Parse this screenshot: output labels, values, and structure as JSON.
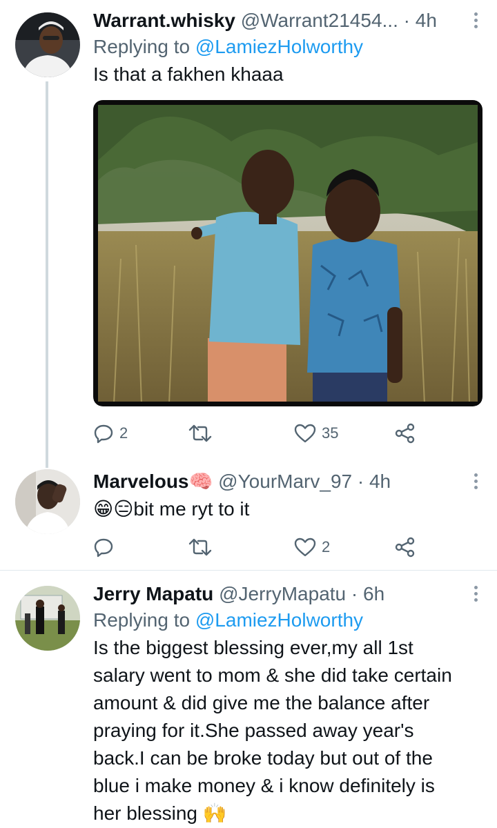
{
  "tweets": [
    {
      "name": "Warrant.whisky",
      "handle": "@Warrant21454...",
      "separator": "·",
      "time": "4h",
      "replying_prefix": "Replying to ",
      "replying_to": "@LamiezHolworthy",
      "text": "Is that a fakhen khaaa",
      "has_media": true,
      "replies": "2",
      "retweets": "",
      "likes": "35"
    },
    {
      "name": "Marvelous",
      "name_emoji": "🧠",
      "handle": "@YourMarv_97",
      "separator": "·",
      "time": "4h",
      "text_emoji": "😁😑",
      "text": "bit me ryt to it",
      "replies": "",
      "retweets": "",
      "likes": "2"
    },
    {
      "name": "Jerry Mapatu",
      "handle": "@JerryMapatu",
      "separator": "·",
      "time": "6h",
      "replying_prefix": "Replying to ",
      "replying_to": "@LamiezHolworthy",
      "text_lines": [
        "Is the biggest blessing ever,my all 1st",
        "salary went to mom & she did take certain",
        "amount & did give me the balance after",
        "praying for it.She passed away year's",
        "back.I can be broke today but out of the",
        "blue i make money & i know definitely is",
        "her blessing 🙌"
      ]
    }
  ],
  "colors": {
    "text": "#0f1419",
    "secondary": "#536471",
    "accent": "#1d9bf0",
    "thread_line": "#cfd9de"
  },
  "icons": [
    "reply-icon",
    "retweet-icon",
    "like-icon",
    "share-icon",
    "more-icon"
  ]
}
